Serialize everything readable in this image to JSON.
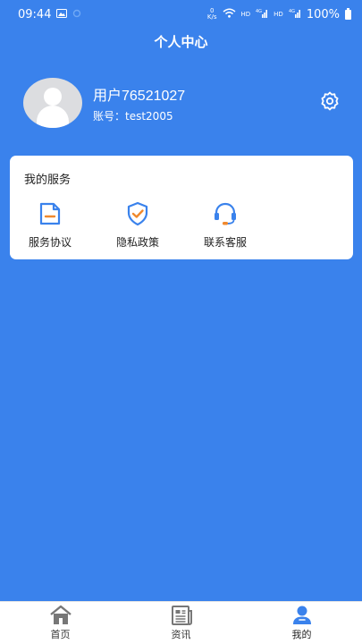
{
  "status_bar": {
    "time": "09:44",
    "speed_value": "0",
    "speed_unit": "K/s",
    "hd1": "HD",
    "net1": "4G",
    "hd2": "HD",
    "net2": "4G",
    "battery": "100%"
  },
  "header": {
    "title": "个人中心"
  },
  "profile": {
    "username": "用户76521027",
    "account": "账号：test2005"
  },
  "services": {
    "title": "我的服务",
    "items": [
      {
        "label": "服务协议",
        "icon": "document-icon"
      },
      {
        "label": "隐私政策",
        "icon": "shield-check-icon"
      },
      {
        "label": "联系客服",
        "icon": "headset-icon"
      }
    ]
  },
  "bottom_nav": {
    "items": [
      {
        "label": "首页",
        "icon": "home-icon"
      },
      {
        "label": "资讯",
        "icon": "news-icon"
      },
      {
        "label": "我的",
        "icon": "person-icon",
        "active": true
      }
    ]
  },
  "colors": {
    "background": "#3a82ec",
    "accent_orange": "#f0892d",
    "accent_blue": "#3a82ec",
    "icon_grey": "#777777"
  }
}
